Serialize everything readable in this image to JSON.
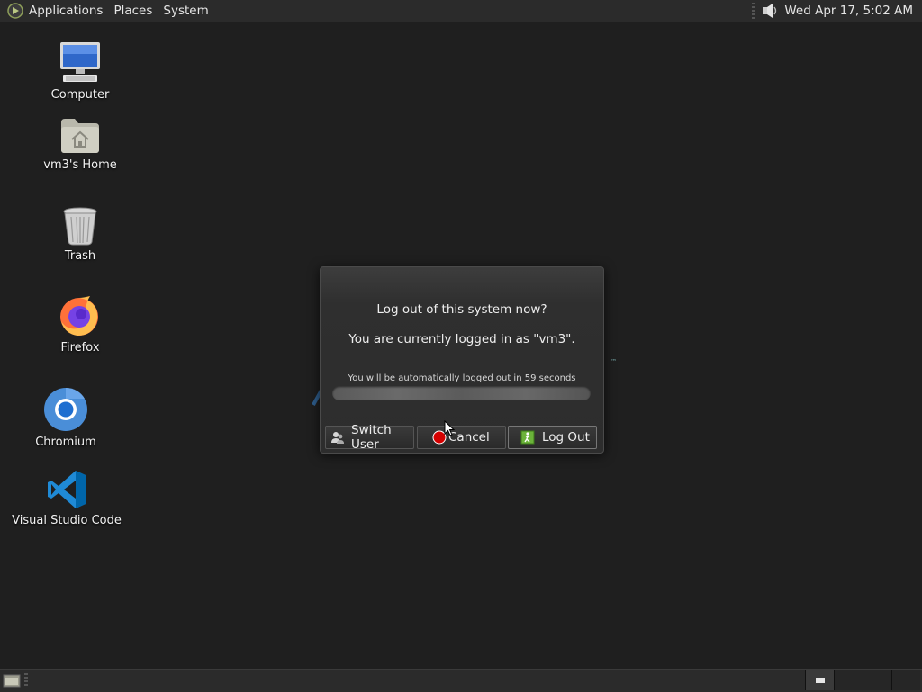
{
  "top_panel": {
    "menus": [
      "Applications",
      "Places",
      "System"
    ],
    "clock": "Wed Apr 17,  5:02 AM"
  },
  "desktop_icons": [
    {
      "label": "Computer",
      "icon": "computer-icon"
    },
    {
      "label": "vm3's Home",
      "icon": "home-folder-icon"
    },
    {
      "label": "Trash",
      "icon": "trash-icon"
    },
    {
      "label": "Firefox",
      "icon": "firefox-icon"
    },
    {
      "label": "Chromium",
      "icon": "chromium-icon"
    },
    {
      "label": "Visual Studio Code",
      "icon": "vscode-icon"
    }
  ],
  "dialog": {
    "question": "Log out of this system now?",
    "logged_in_as": "You are currently logged in as \"vm3\".",
    "countdown": "You will be automatically logged out in 59 seconds",
    "buttons": {
      "switch_user": "Switch User",
      "cancel": "Cancel",
      "log_out": "Log Out"
    }
  },
  "colors": {
    "desktop_bg": "#1f1f1f",
    "panel_bg": "#2b2b2b",
    "cancel_red": "#d40000",
    "logout_green": "#6bb33a",
    "chromium_blue": "#4a8ed8",
    "vscode_blue": "#1f8ad6"
  }
}
